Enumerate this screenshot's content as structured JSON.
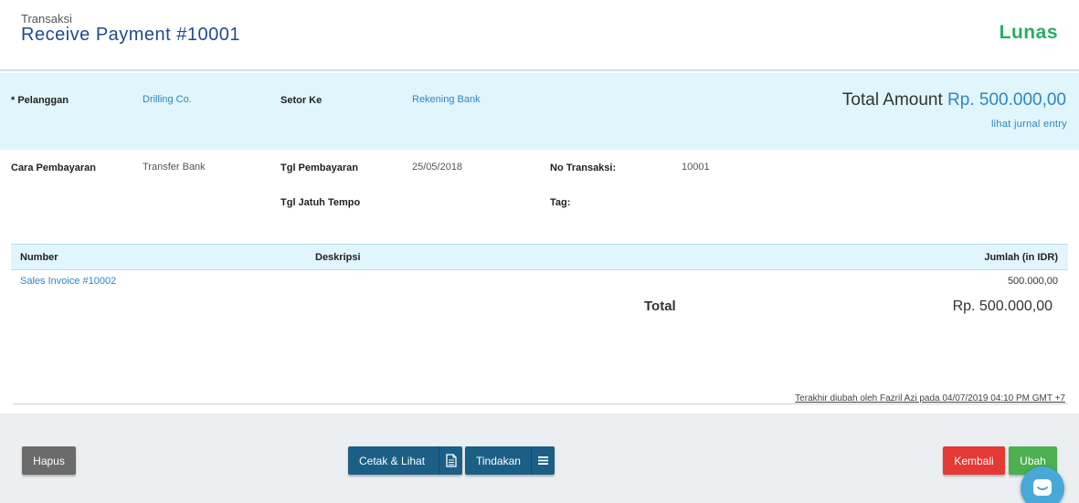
{
  "header": {
    "subtitle": "Transaksi",
    "title": "Receive Payment #10001",
    "status": "Lunas"
  },
  "band": {
    "pelanggan_label": "* Pelanggan",
    "pelanggan_value": "Drilling Co.",
    "setor_label": "Setor Ke",
    "setor_value": "Rekening Bank",
    "total_amount_label": "Total Amount",
    "total_amount_value": "Rp. 500.000,00",
    "jurnal_link": "lihat jurnal entry"
  },
  "details": {
    "cara_label": "Cara Pembayaran",
    "cara_value": "Transfer Bank",
    "tgl_bayar_label": "Tgl Pembayaran",
    "tgl_bayar_value": "25/05/2018",
    "no_transaksi_label": "No Transaksi:",
    "no_transaksi_value": "10001",
    "jatuh_tempo_label": "Tgl Jatuh Tempo",
    "tag_label": "Tag:"
  },
  "table": {
    "columns": [
      "Number",
      "Deskripsi",
      "Jumlah (in IDR)"
    ],
    "rows": [
      {
        "number": "Sales Invoice #10002",
        "deskripsi": "",
        "jumlah": "500.000,00"
      }
    ],
    "total_label": "Total",
    "total_value": "Rp. 500.000,00"
  },
  "audit": "Terakhir diubah oleh Fazril Azi pada 04/07/2019 04:10 PM GMT +7",
  "footer": {
    "hapus": "Hapus",
    "cetak": "Cetak & Lihat",
    "tindakan": "Tindakan",
    "kembali": "Kembali",
    "ubah": "Ubah"
  },
  "colors": {
    "status": "#27ae60",
    "link": "#2e86c1",
    "band": "#e1f5fd",
    "primary_button": "#1b5f86",
    "delete_button": "#6b6b6b",
    "back_button": "#e53935",
    "edit_button": "#4caf50"
  }
}
